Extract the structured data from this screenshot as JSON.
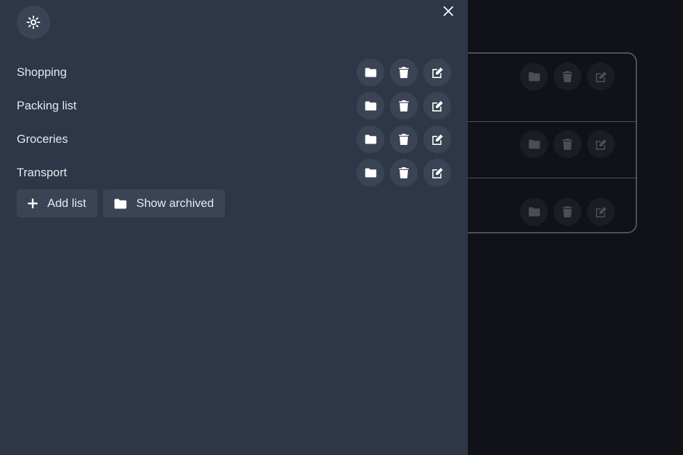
{
  "drawer": {
    "lists": [
      {
        "label": "Shopping"
      },
      {
        "label": "Packing list"
      },
      {
        "label": "Groceries"
      },
      {
        "label": "Transport"
      }
    ],
    "add_list_label": "Add list",
    "show_archived_label": "Show archived"
  },
  "icons": {
    "theme": "sun-gear-icon",
    "close": "close-icon",
    "archive": "folder-icon",
    "delete": "trash-icon",
    "edit": "edit-icon",
    "add": "plus-icon"
  },
  "colors": {
    "drawer_bg": "#2e3748",
    "button_bg": "#3b4454",
    "page_bg": "#101218",
    "text": "#e6e9ef"
  }
}
